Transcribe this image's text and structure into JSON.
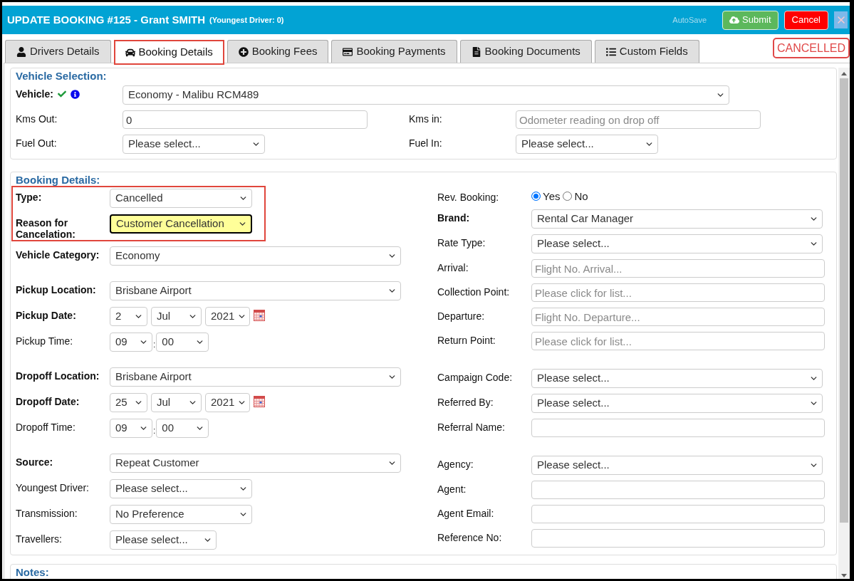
{
  "window": {
    "title": "UPDATE BOOKING #125 - Grant SMITH",
    "note": "(Youngest Driver: 0)",
    "autosave": "AutoSave",
    "buttons": [
      {
        "kind": "submit",
        "label": "Submit"
      },
      {
        "kind": "cancel",
        "label": "Cancel"
      },
      {
        "kind": "close"
      }
    ]
  },
  "tabs": [
    {
      "label": "Drivers Details",
      "selected": false
    },
    {
      "label": "Booking Details",
      "selected": true
    },
    {
      "label": "Booking Fees",
      "selected": false
    },
    {
      "label": "Booking Payments",
      "selected": false
    },
    {
      "label": "Booking Documents",
      "selected": false
    },
    {
      "label": "Custom Fields",
      "selected": false
    }
  ],
  "status_badge": "CANCELLED",
  "vehicle_selection": {
    "title": "Vehicle Selection:",
    "vehicle": {
      "label": "Vehicle:",
      "required": true,
      "verified": true,
      "kind": "select",
      "value": "Economy - Malibu RCM489",
      "flagged": false
    },
    "rows": [
      [
        {
          "label": "Kms Out:",
          "required": false,
          "kind": "input",
          "value": "0"
        },
        {
          "label": "Kms in:",
          "required": false,
          "kind": "input",
          "placeholder": "Odometer reading on drop off"
        }
      ],
      [
        {
          "label": "Fuel Out:",
          "required": false,
          "kind": "select",
          "value": "Please select...",
          "flagged": false
        },
        {
          "label": "Fuel In:",
          "required": false,
          "kind": "select",
          "value": "Please select...",
          "flagged": false
        }
      ]
    ]
  },
  "booking_details": {
    "title": "Booking Details:",
    "left": [
      {
        "highlighted": true,
        "fields": [
          {
            "label": "Type:",
            "required": true,
            "kind": "select",
            "value": "Cancelled",
            "flagged": false
          },
          {
            "label": "Reason for Cancelation:",
            "required": true,
            "kind": "select",
            "value": "Customer Cancellation",
            "flagged": true
          }
        ]
      },
      {
        "highlighted": false,
        "fields": [
          {
            "label": "Vehicle Category:",
            "required": true,
            "kind": "select",
            "value": "Economy",
            "flagged": false
          }
        ]
      },
      {
        "highlighted": false,
        "fields": [
          {
            "label": "Pickup Location:",
            "required": true,
            "kind": "select",
            "value": "Brisbane Airport",
            "flagged": false
          },
          {
            "label": "Pickup Date:",
            "required": true,
            "kind": "date",
            "day": "2",
            "month": "Jul",
            "year": "2021"
          },
          {
            "label": "Pickup Time:",
            "required": false,
            "kind": "time",
            "hour": "09",
            "separator": ":",
            "minute": "00"
          }
        ]
      },
      {
        "highlighted": false,
        "fields": [
          {
            "label": "Dropoff Location:",
            "required": true,
            "kind": "select",
            "value": "Brisbane Airport",
            "flagged": false
          },
          {
            "label": "Dropoff Date:",
            "required": true,
            "kind": "date",
            "day": "25",
            "month": "Jul",
            "year": "2021"
          },
          {
            "label": "Dropoff Time:",
            "required": false,
            "kind": "time",
            "hour": "09",
            "separator": ":",
            "minute": "00"
          }
        ]
      },
      {
        "highlighted": false,
        "fields": [
          {
            "label": "Source:",
            "required": true,
            "kind": "select",
            "value": "Repeat Customer",
            "flagged": false
          },
          {
            "label": "Youngest Driver:",
            "required": false,
            "kind": "select",
            "value": "Please select...",
            "flagged": false
          },
          {
            "label": "Transmission:",
            "required": false,
            "kind": "select",
            "value": "No Preference",
            "flagged": false
          },
          {
            "label": "Travellers:",
            "required": false,
            "kind": "select",
            "value": "Please select...",
            "flagged": false
          }
        ]
      }
    ],
    "right": [
      [
        {
          "label": "Rev. Booking:",
          "required": false,
          "kind": "radio",
          "options": [
            {
              "label": "Yes",
              "selected": true
            },
            {
              "label": "No",
              "selected": false
            }
          ]
        },
        {
          "label": "Brand:",
          "required": true,
          "kind": "select",
          "value": "Rental Car Manager",
          "flagged": false
        },
        {
          "label": "Rate Type:",
          "required": false,
          "kind": "select",
          "value": "Please select...",
          "flagged": false
        },
        {
          "label": "Arrival:",
          "required": false,
          "kind": "input",
          "placeholder": "Flight No. Arrival..."
        },
        {
          "label": "Collection Point:",
          "required": false,
          "kind": "input",
          "placeholder": "Please click for list..."
        },
        {
          "label": "Departure:",
          "required": false,
          "kind": "input",
          "placeholder": "Flight No. Departure..."
        },
        {
          "label": "Return Point:",
          "required": false,
          "kind": "input",
          "placeholder": "Please click for list..."
        }
      ],
      [
        {
          "label": "Campaign Code:",
          "required": false,
          "kind": "select",
          "value": "Please select...",
          "flagged": false
        },
        {
          "label": "Referred By:",
          "required": false,
          "kind": "select",
          "value": "Please select...",
          "flagged": false
        },
        {
          "label": "Referral Name:",
          "required": false,
          "kind": "input"
        }
      ],
      [
        {
          "label": "Agency:",
          "required": false,
          "kind": "select",
          "value": "Please select...",
          "flagged": false
        },
        {
          "label": "Agent:",
          "required": false,
          "kind": "input"
        },
        {
          "label": "Agent Email:",
          "required": false,
          "kind": "input"
        },
        {
          "label": "Reference No:",
          "required": false,
          "kind": "input"
        }
      ]
    ]
  },
  "notes": {
    "title": "Notes:"
  }
}
